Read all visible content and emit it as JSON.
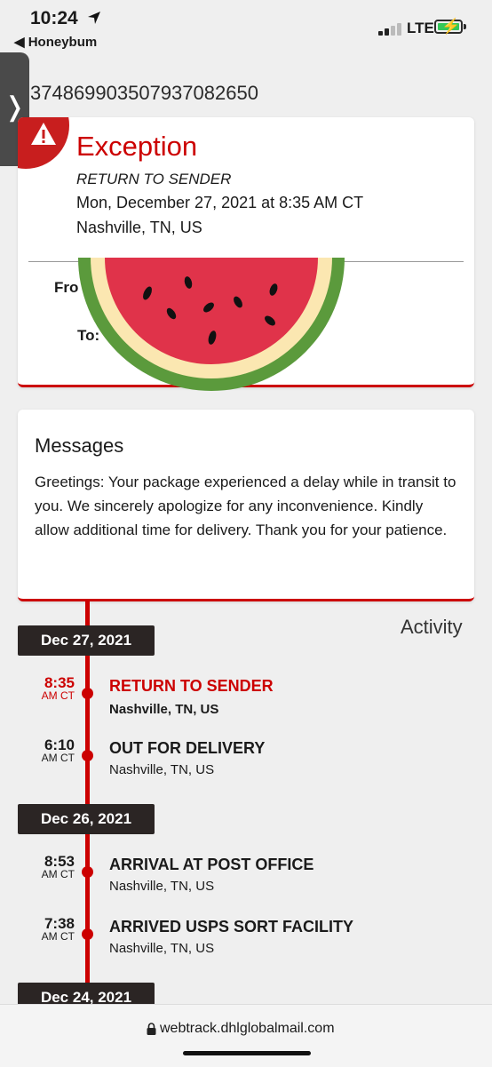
{
  "status": {
    "time": "10:24",
    "back_app": "◀ Honeybum",
    "network": "LTE",
    "colors": {
      "battery": "#34c759"
    }
  },
  "tracking_number": "374869903507937082650",
  "exception": {
    "title": "Exception",
    "status": "RETURN TO SENDER",
    "datetime": "Mon, December 27, 2021 at 8:35 AM CT",
    "location": "Nashville, TN, US",
    "from_label": "Fro",
    "to_label": "To:",
    "icon": "warning-icon",
    "accent": "#cc0000"
  },
  "messages": {
    "title": "Messages",
    "body": "Greetings: Your package experienced a delay while in transit to you. We sincerely apologize for any inconvenience. Kindly allow additional time for delivery. Thank you for your patience."
  },
  "activity": {
    "title": "Activity",
    "groups": [
      {
        "date": "Dec 27, 2021",
        "events": [
          {
            "time": "8:35",
            "tz": "AM CT",
            "title": "RETURN TO SENDER",
            "location": "Nashville, TN, US"
          },
          {
            "time": "6:10",
            "tz": "AM CT",
            "title": "OUT FOR DELIVERY",
            "location": "Nashville, TN, US"
          }
        ]
      },
      {
        "date": "Dec 26, 2021",
        "events": [
          {
            "time": "8:53",
            "tz": "AM CT",
            "title": "ARRIVAL AT POST OFFICE",
            "location": "Nashville, TN, US"
          },
          {
            "time": "7:38",
            "tz": "AM CT",
            "title": "ARRIVED USPS SORT FACILITY",
            "location": "Nashville, TN, US"
          }
        ]
      },
      {
        "date": "Dec 24, 2021",
        "events": []
      }
    ]
  },
  "browser": {
    "url": "webtrack.dhlglobalmail.com"
  }
}
